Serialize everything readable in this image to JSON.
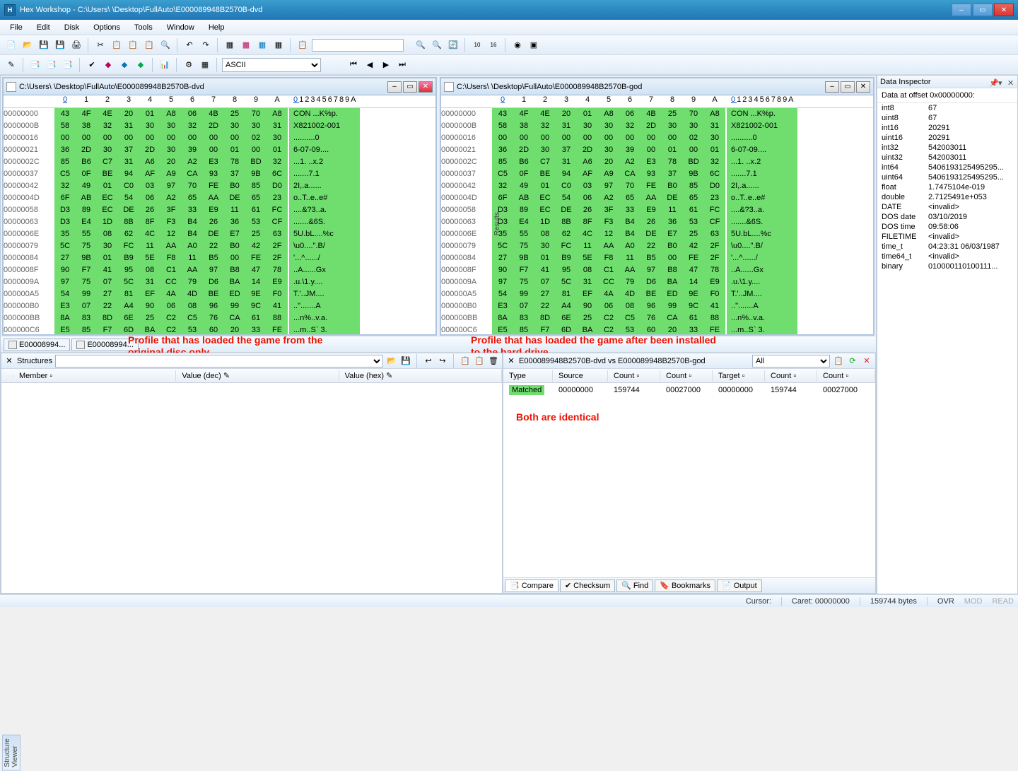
{
  "title": "Hex Workshop - C:\\Users\\        \\Desktop\\FullAuto\\E000089948B2570B-dvd",
  "menu": [
    "File",
    "Edit",
    "Disk",
    "Options",
    "Tools",
    "Window",
    "Help"
  ],
  "encoding": "ASCII",
  "fileTabs": [
    "E00008994...",
    "E00008994..."
  ],
  "hexLeft": {
    "path": "C:\\Users\\        \\Desktop\\FullAuto\\E000089948B2570B-dvd"
  },
  "hexRight": {
    "path": "C:\\Users\\        \\Desktop\\FullAuto\\E000089948B2570B-god"
  },
  "hexHeaderBytes": [
    "0",
    "1",
    "2",
    "3",
    "4",
    "5",
    "6",
    "7",
    "8",
    "9",
    "A"
  ],
  "hexHeaderAscii": "0123456789A",
  "hexLines": [
    {
      "off": "00000000",
      "b": [
        "43",
        "4F",
        "4E",
        "20",
        "01",
        "A8",
        "06",
        "4B",
        "25",
        "70",
        "A8"
      ],
      "a": "CON ...K%p."
    },
    {
      "off": "0000000B",
      "b": [
        "58",
        "38",
        "32",
        "31",
        "30",
        "30",
        "32",
        "2D",
        "30",
        "30",
        "31"
      ],
      "a": "X821002-001"
    },
    {
      "off": "00000016",
      "b": [
        "00",
        "00",
        "00",
        "00",
        "00",
        "00",
        "00",
        "00",
        "00",
        "02",
        "30"
      ],
      "a": "..........0"
    },
    {
      "off": "00000021",
      "b": [
        "36",
        "2D",
        "30",
        "37",
        "2D",
        "30",
        "39",
        "00",
        "01",
        "00",
        "01"
      ],
      "a": "6-07-09...."
    },
    {
      "off": "0000002C",
      "b": [
        "85",
        "B6",
        "C7",
        "31",
        "A6",
        "20",
        "A2",
        "E3",
        "78",
        "BD",
        "32"
      ],
      "a": "...1. ..x.2"
    },
    {
      "off": "00000037",
      "b": [
        "C5",
        "0F",
        "BE",
        "94",
        "AF",
        "A9",
        "CA",
        "93",
        "37",
        "9B",
        "6C"
      ],
      "a": ".......7.1"
    },
    {
      "off": "00000042",
      "b": [
        "32",
        "49",
        "01",
        "C0",
        "03",
        "97",
        "70",
        "FE",
        "B0",
        "85",
        "D0"
      ],
      "a": "2I,.a......"
    },
    {
      "off": "0000004D",
      "b": [
        "6F",
        "AB",
        "EC",
        "54",
        "06",
        "A2",
        "65",
        "AA",
        "DE",
        "65",
        "23"
      ],
      "a": "o..T..e..e#"
    },
    {
      "off": "00000058",
      "b": [
        "D3",
        "89",
        "EC",
        "DE",
        "26",
        "3F",
        "33",
        "E9",
        "11",
        "61",
        "FC"
      ],
      "a": "....&?3..a."
    },
    {
      "off": "00000063",
      "b": [
        "D3",
        "E4",
        "1D",
        "8B",
        "8F",
        "F3",
        "B4",
        "26",
        "36",
        "53",
        "CF"
      ],
      "a": ".......&6S."
    },
    {
      "off": "0000006E",
      "b": [
        "35",
        "55",
        "08",
        "62",
        "4C",
        "12",
        "B4",
        "DE",
        "E7",
        "25",
        "63"
      ],
      "a": "5U.bL....%c"
    },
    {
      "off": "00000079",
      "b": [
        "5C",
        "75",
        "30",
        "FC",
        "11",
        "AA",
        "A0",
        "22",
        "B0",
        "42",
        "2F"
      ],
      "a": "\\u0....\".B/"
    },
    {
      "off": "00000084",
      "b": [
        "27",
        "9B",
        "01",
        "B9",
        "5E",
        "F8",
        "11",
        "B5",
        "00",
        "FE",
        "2F"
      ],
      "a": "'...^....../"
    },
    {
      "off": "0000008F",
      "b": [
        "90",
        "F7",
        "41",
        "95",
        "08",
        "C1",
        "AA",
        "97",
        "B8",
        "47",
        "78"
      ],
      "a": "..A......Gx"
    },
    {
      "off": "0000009A",
      "b": [
        "97",
        "75",
        "07",
        "5C",
        "31",
        "CC",
        "79",
        "D6",
        "BA",
        "14",
        "E9"
      ],
      "a": ".u.\\1.y...."
    },
    {
      "off": "000000A5",
      "b": [
        "54",
        "99",
        "27",
        "81",
        "EF",
        "4A",
        "4D",
        "BE",
        "ED",
        "9E",
        "F0"
      ],
      "a": "T.'..JM...."
    },
    {
      "off": "000000B0",
      "b": [
        "E3",
        "07",
        "22",
        "A4",
        "90",
        "06",
        "08",
        "96",
        "99",
        "9C",
        "41"
      ],
      "a": "..\".......A"
    },
    {
      "off": "000000BB",
      "b": [
        "8A",
        "83",
        "8D",
        "6E",
        "25",
        "C2",
        "C5",
        "76",
        "CA",
        "61",
        "88"
      ],
      "a": "...n%..v.a."
    },
    {
      "off": "000000C6",
      "b": [
        "E5",
        "85",
        "F7",
        "6D",
        "BA",
        "C2",
        "53",
        "60",
        "20",
        "33",
        "FE"
      ],
      "a": "...m..S` 3."
    }
  ],
  "annotations": {
    "left": "Profile that has loaded the game from the original disc only.",
    "right": "Profile that has loaded the game after been installed to the hard drive.",
    "identical": "Both are identical"
  },
  "structures": {
    "label": "Structures",
    "cols": [
      "Member",
      "Value (dec)",
      "Value (hex)"
    ],
    "sideLabel": "Structure Viewer"
  },
  "results": {
    "title": "E000089948B2570B-dvd vs E000089948B2570B-god",
    "filter": "All",
    "cols": [
      "Type",
      "Source",
      "Count",
      "Count",
      "Target",
      "Count",
      "Count"
    ],
    "row": {
      "type": "Matched",
      "source": "00000000",
      "count1": "159744",
      "count2": "00027000",
      "target": "00000000",
      "count3": "159744",
      "count4": "00027000"
    },
    "tabs": [
      "Compare",
      "Checksum",
      "Find",
      "Bookmarks",
      "Output"
    ],
    "sideLabel": "Results"
  },
  "dataInspector": {
    "title": "Data Inspector",
    "offset": "Data at offset 0x00000000:",
    "rows": [
      {
        "k": "int8",
        "v": "67"
      },
      {
        "k": "uint8",
        "v": "67"
      },
      {
        "k": "int16",
        "v": "20291"
      },
      {
        "k": "uint16",
        "v": "20291"
      },
      {
        "k": "int32",
        "v": "542003011"
      },
      {
        "k": "uint32",
        "v": "542003011"
      },
      {
        "k": "int64",
        "v": "5406193125495295..."
      },
      {
        "k": "uint64",
        "v": "5406193125495295..."
      },
      {
        "k": "float",
        "v": "1.7475104e-019"
      },
      {
        "k": "double",
        "v": "2.7125491e+053"
      },
      {
        "k": "DATE",
        "v": "<invalid>"
      },
      {
        "k": "DOS date",
        "v": "03/10/2019"
      },
      {
        "k": "DOS time",
        "v": "09:58:06"
      },
      {
        "k": "FILETIME",
        "v": "<invalid>"
      },
      {
        "k": "time_t",
        "v": "04:23:31 06/03/1987"
      },
      {
        "k": "time64_t",
        "v": "<invalid>"
      },
      {
        "k": "binary",
        "v": "010000110100111..."
      }
    ]
  },
  "status": {
    "cursor": "Cursor:",
    "caret": "Caret: 00000000",
    "bytes": "159744 bytes",
    "ovr": "OVR",
    "mod": "MOD",
    "read": "READ"
  }
}
